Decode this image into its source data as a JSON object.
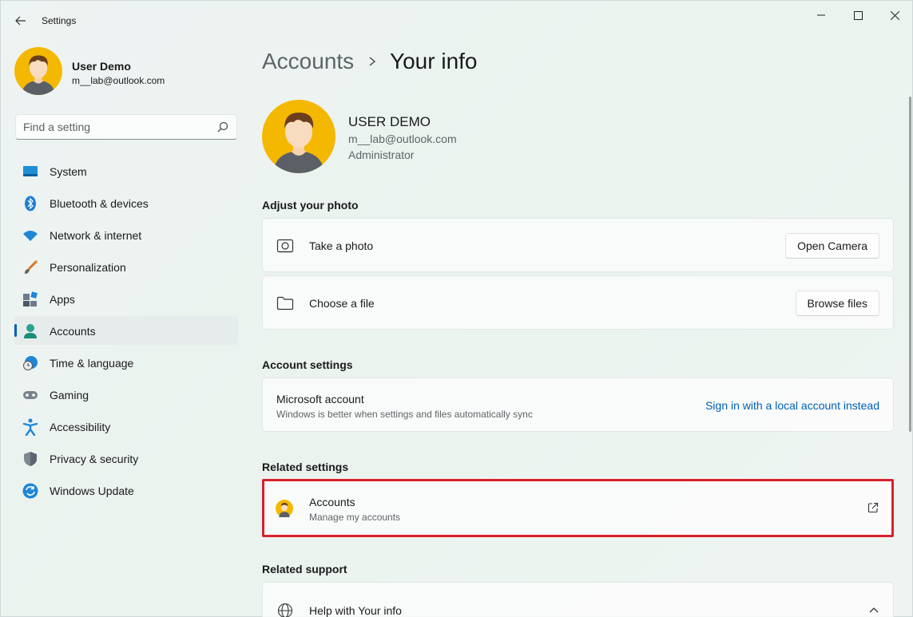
{
  "window": {
    "title": "Settings",
    "controls": {
      "minimize": "minimize-icon",
      "maximize": "maximize-icon",
      "close": "close-icon"
    }
  },
  "profile": {
    "name": "User Demo",
    "email": "m__lab@outlook.com"
  },
  "search": {
    "placeholder": "Find a setting"
  },
  "sidebar": {
    "items": [
      {
        "label": "System",
        "icon": "system-icon"
      },
      {
        "label": "Bluetooth & devices",
        "icon": "bluetooth-icon"
      },
      {
        "label": "Network & internet",
        "icon": "wifi-icon"
      },
      {
        "label": "Personalization",
        "icon": "brush-icon"
      },
      {
        "label": "Apps",
        "icon": "apps-icon"
      },
      {
        "label": "Accounts",
        "icon": "accounts-icon",
        "active": true
      },
      {
        "label": "Time & language",
        "icon": "clock-globe-icon"
      },
      {
        "label": "Gaming",
        "icon": "gamepad-icon"
      },
      {
        "label": "Accessibility",
        "icon": "accessibility-icon"
      },
      {
        "label": "Privacy & security",
        "icon": "shield-icon"
      },
      {
        "label": "Windows Update",
        "icon": "update-icon"
      }
    ]
  },
  "breadcrumb": {
    "parent": "Accounts",
    "current": "Your info"
  },
  "user": {
    "name": "USER DEMO",
    "email": "m__lab@outlook.com",
    "role": "Administrator"
  },
  "photo_section": {
    "title": "Adjust your photo",
    "take_photo": {
      "label": "Take a photo",
      "button": "Open Camera"
    },
    "choose_file": {
      "label": "Choose a file",
      "button": "Browse files"
    }
  },
  "account_settings": {
    "title": "Account settings",
    "microsoft_account": {
      "label": "Microsoft account",
      "description": "Windows is better when settings and files automatically sync",
      "link": "Sign in with a local account instead"
    }
  },
  "related_settings": {
    "title": "Related settings",
    "accounts": {
      "label": "Accounts",
      "description": "Manage my accounts"
    },
    "highlight_color": "#d6222a"
  },
  "related_support": {
    "title": "Related support",
    "help": {
      "label": "Help with Your info"
    }
  },
  "colors": {
    "accent": "#005fb8",
    "avatar_bg": "#f5b800"
  }
}
